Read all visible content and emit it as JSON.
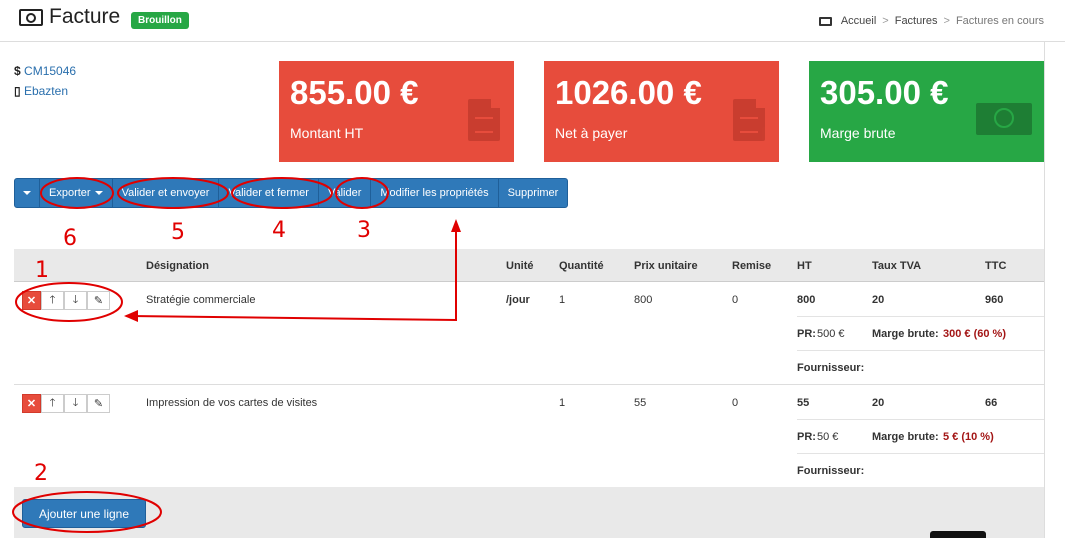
{
  "header": {
    "title": "Facture",
    "status_badge": "Brouillon",
    "breadcrumb": [
      "Accueil",
      "Factures",
      "Factures en cours"
    ],
    "title_icon": "money-icon"
  },
  "info": {
    "reference": "CM15046",
    "reference_glyph": "$",
    "client": "Ebazten",
    "client_icon": "building-icon"
  },
  "cards": [
    {
      "value": "855.00 €",
      "label": "Montant HT",
      "color": "#e74c3c",
      "icon": "document-icon"
    },
    {
      "value": "1026.00 €",
      "label": "Net à payer",
      "color": "#e74c3c",
      "icon": "document-icon"
    },
    {
      "value": "305.00 €",
      "label": "Marge brute",
      "color": "#27a745",
      "icon": "money-icon"
    }
  ],
  "toolbar": {
    "buttons": [
      "Exporter",
      "Valider et envoyer",
      "Valider et fermer",
      "Valider",
      "Modifier les propriétés",
      "Supprimer"
    ]
  },
  "table": {
    "columns": [
      "Désignation",
      "Unité",
      "Quantité",
      "Prix unitaire",
      "Remise",
      "HT",
      "Taux TVA",
      "TTC"
    ],
    "rows": [
      {
        "designation": "Stratégie commerciale",
        "unite": "/jour",
        "quantite": "1",
        "prix_unitaire": "800",
        "remise": "0",
        "ht": "800",
        "taux_tva": "20",
        "ttc": "960",
        "pr_label": "PR:",
        "pr_value": "500 €",
        "marge_label": "Marge brute:",
        "marge_value": "300 € (60 %)",
        "fournisseur_label": "Fournisseur:"
      },
      {
        "designation": "Impression de vos cartes de visites",
        "unite": "",
        "quantite": "1",
        "prix_unitaire": "55",
        "remise": "0",
        "ht": "55",
        "taux_tva": "20",
        "ttc": "66",
        "pr_label": "PR:",
        "pr_value": "50 €",
        "marge_label": "Marge brute:",
        "marge_value": "5 € (10 %)",
        "fournisseur_label": "Fournisseur:"
      }
    ]
  },
  "footer": {
    "add_line": "Ajouter une ligne"
  },
  "annotations": [
    "1",
    "2",
    "3",
    "4",
    "5",
    "6"
  ],
  "colors": {
    "primary": "#2f79b9",
    "danger": "#e74c3c",
    "success": "#27a745",
    "annotation": "#e00000",
    "margin_text": "#a31515"
  }
}
